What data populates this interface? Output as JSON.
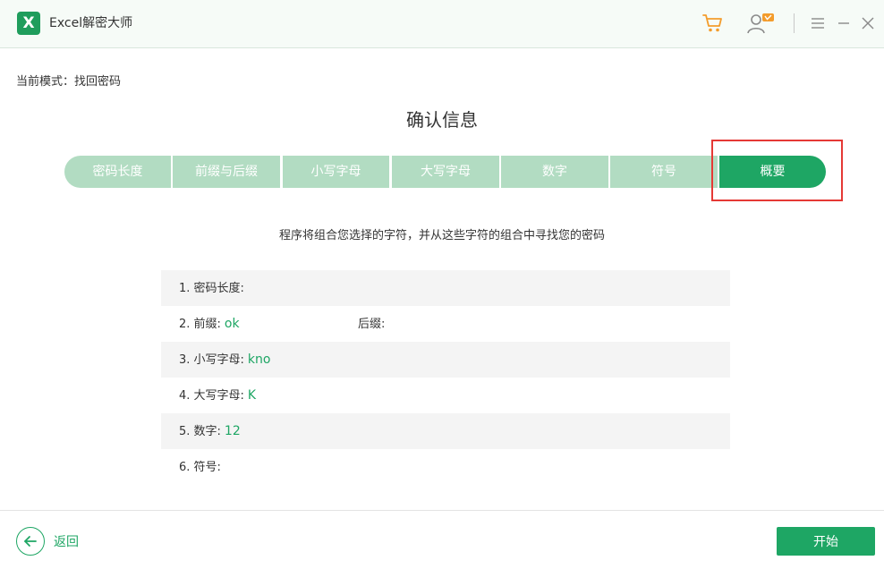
{
  "app": {
    "logo_letter": "X",
    "title": "Excel解密大师"
  },
  "titlebar_icons": [
    "cart-icon",
    "user-vip-icon",
    "menu-icon",
    "minimize-icon",
    "close-icon"
  ],
  "mode": {
    "label": "当前模式：",
    "value": "找回密码"
  },
  "page_title": "确认信息",
  "steps": [
    {
      "label": "密码长度",
      "active": false
    },
    {
      "label": "前缀与后缀",
      "active": false
    },
    {
      "label": "小写字母",
      "active": false
    },
    {
      "label": "大写字母",
      "active": false
    },
    {
      "label": "数字",
      "active": false
    },
    {
      "label": "符号",
      "active": false
    },
    {
      "label": "概要",
      "active": true
    }
  ],
  "description": "程序将组合您选择的字符，并从这些字符的组合中寻找您的密码",
  "summary": {
    "length": {
      "label": "1. 密码长度:",
      "value": ""
    },
    "prefix": {
      "label": "2. 前缀:",
      "value": "ok"
    },
    "suffix": {
      "label": "后缀:",
      "value": ""
    },
    "lowercase": {
      "label": "3. 小写字母:",
      "value": "kno"
    },
    "uppercase": {
      "label": "4. 大写字母:",
      "value": "K"
    },
    "digits": {
      "label": "5. 数字:",
      "value": "12"
    },
    "symbols": {
      "label": "6. 符号:",
      "value": ""
    }
  },
  "footer": {
    "back_label": "返回",
    "start_label": "开始"
  },
  "colors": {
    "accent": "#1ea664",
    "step_inactive": "#b2dcc2",
    "highlight": "#e53935"
  }
}
